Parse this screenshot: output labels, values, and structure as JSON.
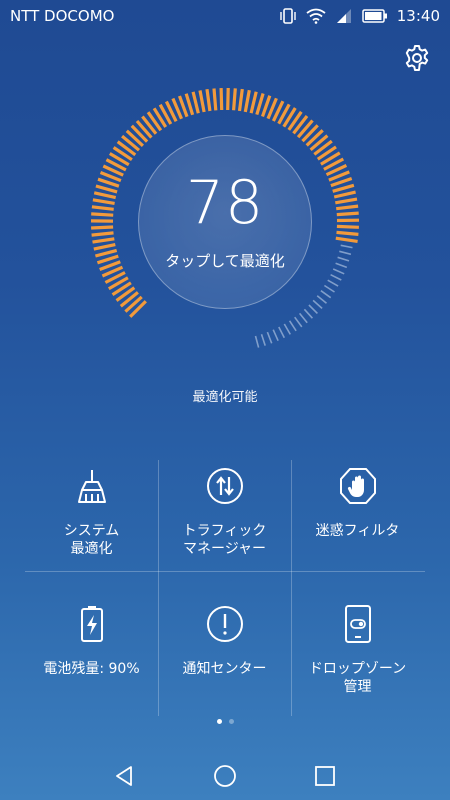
{
  "status_bar": {
    "carrier": "NTT DOCOMO",
    "time": "13:40",
    "icons": [
      "vibrate-icon",
      "wifi-icon",
      "signal-icon",
      "battery-icon"
    ]
  },
  "optimizer": {
    "score": "78",
    "tap_label": "タップして最適化",
    "status": "最適化可能",
    "score_fraction": 0.78,
    "progress_color": "#f29a3b",
    "remaining_color": "#9fb7d9"
  },
  "settings_icon": "gear-icon",
  "tiles": [
    {
      "label": "システム\n最適化",
      "icon": "broom-icon"
    },
    {
      "label": "トラフィック\nマネージャー",
      "icon": "traffic-arrows-icon"
    },
    {
      "label": "迷惑フィルタ",
      "icon": "hand-block-icon"
    },
    {
      "label": "電池残量: 90%",
      "icon": "battery-charging-icon"
    },
    {
      "label": "通知センター",
      "icon": "exclamation-icon"
    },
    {
      "label": "ドロップゾーン\n管理",
      "icon": "phone-toggle-icon"
    }
  ],
  "pager": {
    "pages": 2,
    "current": 1
  },
  "navigation": [
    "back-icon",
    "home-icon",
    "recents-icon"
  ]
}
